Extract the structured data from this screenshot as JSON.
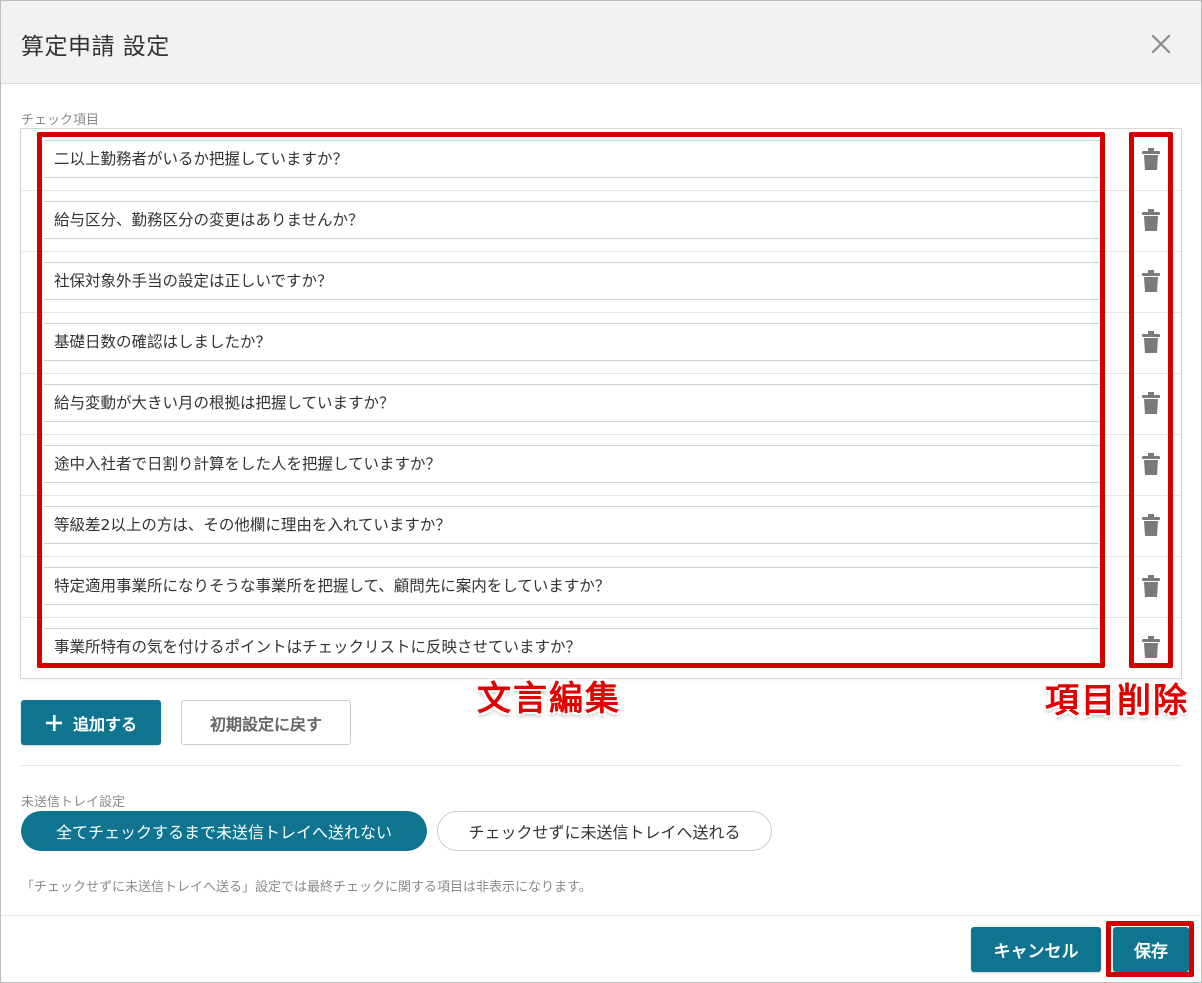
{
  "dialog": {
    "title": "算定申請 設定"
  },
  "check_items": {
    "label": "チェック項目",
    "items": [
      "二以上勤務者がいるか把握していますか？",
      "給与区分、勤務区分の変更はありませんか？",
      "社保対象外手当の設定は正しいですか？",
      "基礎日数の確認はしましたか？",
      "給与変動が大きい月の根拠は把握していますか？",
      "途中入社者で日割り計算をした人を把握していますか？",
      "等級差2以上の方は、その他欄に理由を入れていますか？",
      "特定適用事業所になりそうな事業所を把握して、顧問先に案内をしていますか？",
      "事業所特有の気を付けるポイントはチェックリストに反映させていますか？"
    ],
    "add_label": "追加する",
    "reset_label": "初期設定に戻す"
  },
  "annotations": {
    "edit_text": "文言編集",
    "delete_item": "項目削除"
  },
  "tray": {
    "label": "未送信トレイ設定",
    "option_active": "全てチェックするまで未送信トレイへ送れない",
    "option_inactive": "チェックせずに未送信トレイへ送れる",
    "note": "「チェックせずに未送信トレイへ送る」設定では最終チェックに関する項目は非表示になります。"
  },
  "footer": {
    "cancel_label": "キャンセル",
    "save_label": "保存"
  },
  "colors": {
    "primary": "#0e7490",
    "annotation": "#d40000"
  }
}
